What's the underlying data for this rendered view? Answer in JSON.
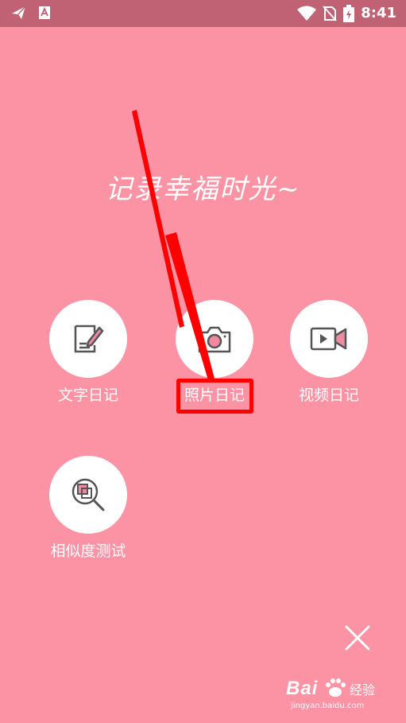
{
  "status_bar": {
    "time": "8:41",
    "left_icons": [
      "paper-plane-icon",
      "translate-app-icon"
    ],
    "right_icons": [
      "wifi-icon",
      "no-sim-icon",
      "battery-charging-icon"
    ]
  },
  "slogan": "记录幸福时光~",
  "menu": {
    "items": [
      {
        "label": "文字日记",
        "icon": "text-diary-icon"
      },
      {
        "label": "照片日记",
        "icon": "camera-icon"
      },
      {
        "label": "视频日记",
        "icon": "video-camera-icon"
      },
      {
        "label": "相似度测试",
        "icon": "similarity-search-icon"
      }
    ]
  },
  "annotation": {
    "highlight_color": "#ff0000"
  },
  "colors": {
    "background": "#fc93a4",
    "status_bar": "#c16174",
    "icon_stroke": "#555555",
    "accent_pink": "#f08aa0"
  },
  "watermark": {
    "brand": "Bai",
    "subtitle": "经验",
    "url": "jingyan.baidu.com"
  }
}
